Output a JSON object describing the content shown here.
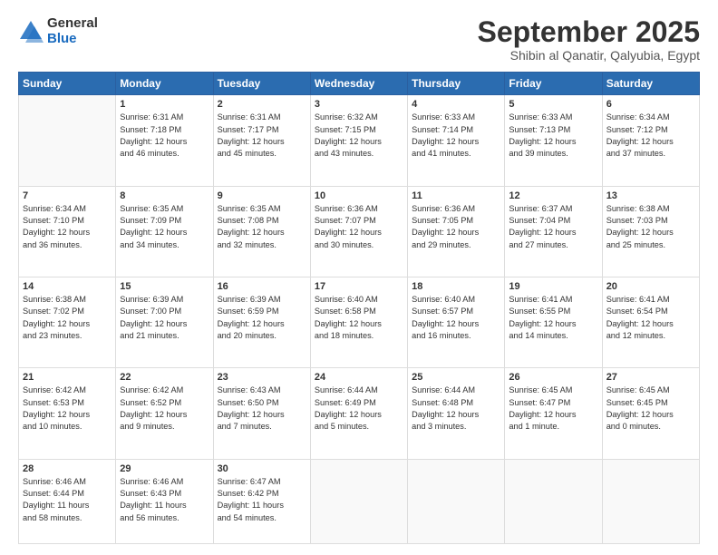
{
  "logo": {
    "general": "General",
    "blue": "Blue"
  },
  "header": {
    "month": "September 2025",
    "subtitle": "Shibin al Qanatir, Qalyubia, Egypt"
  },
  "weekdays": [
    "Sunday",
    "Monday",
    "Tuesday",
    "Wednesday",
    "Thursday",
    "Friday",
    "Saturday"
  ],
  "weeks": [
    [
      {
        "day": "",
        "info": ""
      },
      {
        "day": "1",
        "info": "Sunrise: 6:31 AM\nSunset: 7:18 PM\nDaylight: 12 hours\nand 46 minutes."
      },
      {
        "day": "2",
        "info": "Sunrise: 6:31 AM\nSunset: 7:17 PM\nDaylight: 12 hours\nand 45 minutes."
      },
      {
        "day": "3",
        "info": "Sunrise: 6:32 AM\nSunset: 7:15 PM\nDaylight: 12 hours\nand 43 minutes."
      },
      {
        "day": "4",
        "info": "Sunrise: 6:33 AM\nSunset: 7:14 PM\nDaylight: 12 hours\nand 41 minutes."
      },
      {
        "day": "5",
        "info": "Sunrise: 6:33 AM\nSunset: 7:13 PM\nDaylight: 12 hours\nand 39 minutes."
      },
      {
        "day": "6",
        "info": "Sunrise: 6:34 AM\nSunset: 7:12 PM\nDaylight: 12 hours\nand 37 minutes."
      }
    ],
    [
      {
        "day": "7",
        "info": "Sunrise: 6:34 AM\nSunset: 7:10 PM\nDaylight: 12 hours\nand 36 minutes."
      },
      {
        "day": "8",
        "info": "Sunrise: 6:35 AM\nSunset: 7:09 PM\nDaylight: 12 hours\nand 34 minutes."
      },
      {
        "day": "9",
        "info": "Sunrise: 6:35 AM\nSunset: 7:08 PM\nDaylight: 12 hours\nand 32 minutes."
      },
      {
        "day": "10",
        "info": "Sunrise: 6:36 AM\nSunset: 7:07 PM\nDaylight: 12 hours\nand 30 minutes."
      },
      {
        "day": "11",
        "info": "Sunrise: 6:36 AM\nSunset: 7:05 PM\nDaylight: 12 hours\nand 29 minutes."
      },
      {
        "day": "12",
        "info": "Sunrise: 6:37 AM\nSunset: 7:04 PM\nDaylight: 12 hours\nand 27 minutes."
      },
      {
        "day": "13",
        "info": "Sunrise: 6:38 AM\nSunset: 7:03 PM\nDaylight: 12 hours\nand 25 minutes."
      }
    ],
    [
      {
        "day": "14",
        "info": "Sunrise: 6:38 AM\nSunset: 7:02 PM\nDaylight: 12 hours\nand 23 minutes."
      },
      {
        "day": "15",
        "info": "Sunrise: 6:39 AM\nSunset: 7:00 PM\nDaylight: 12 hours\nand 21 minutes."
      },
      {
        "day": "16",
        "info": "Sunrise: 6:39 AM\nSunset: 6:59 PM\nDaylight: 12 hours\nand 20 minutes."
      },
      {
        "day": "17",
        "info": "Sunrise: 6:40 AM\nSunset: 6:58 PM\nDaylight: 12 hours\nand 18 minutes."
      },
      {
        "day": "18",
        "info": "Sunrise: 6:40 AM\nSunset: 6:57 PM\nDaylight: 12 hours\nand 16 minutes."
      },
      {
        "day": "19",
        "info": "Sunrise: 6:41 AM\nSunset: 6:55 PM\nDaylight: 12 hours\nand 14 minutes."
      },
      {
        "day": "20",
        "info": "Sunrise: 6:41 AM\nSunset: 6:54 PM\nDaylight: 12 hours\nand 12 minutes."
      }
    ],
    [
      {
        "day": "21",
        "info": "Sunrise: 6:42 AM\nSunset: 6:53 PM\nDaylight: 12 hours\nand 10 minutes."
      },
      {
        "day": "22",
        "info": "Sunrise: 6:42 AM\nSunset: 6:52 PM\nDaylight: 12 hours\nand 9 minutes."
      },
      {
        "day": "23",
        "info": "Sunrise: 6:43 AM\nSunset: 6:50 PM\nDaylight: 12 hours\nand 7 minutes."
      },
      {
        "day": "24",
        "info": "Sunrise: 6:44 AM\nSunset: 6:49 PM\nDaylight: 12 hours\nand 5 minutes."
      },
      {
        "day": "25",
        "info": "Sunrise: 6:44 AM\nSunset: 6:48 PM\nDaylight: 12 hours\nand 3 minutes."
      },
      {
        "day": "26",
        "info": "Sunrise: 6:45 AM\nSunset: 6:47 PM\nDaylight: 12 hours\nand 1 minute."
      },
      {
        "day": "27",
        "info": "Sunrise: 6:45 AM\nSunset: 6:45 PM\nDaylight: 12 hours\nand 0 minutes."
      }
    ],
    [
      {
        "day": "28",
        "info": "Sunrise: 6:46 AM\nSunset: 6:44 PM\nDaylight: 11 hours\nand 58 minutes."
      },
      {
        "day": "29",
        "info": "Sunrise: 6:46 AM\nSunset: 6:43 PM\nDaylight: 11 hours\nand 56 minutes."
      },
      {
        "day": "30",
        "info": "Sunrise: 6:47 AM\nSunset: 6:42 PM\nDaylight: 11 hours\nand 54 minutes."
      },
      {
        "day": "",
        "info": ""
      },
      {
        "day": "",
        "info": ""
      },
      {
        "day": "",
        "info": ""
      },
      {
        "day": "",
        "info": ""
      }
    ]
  ]
}
